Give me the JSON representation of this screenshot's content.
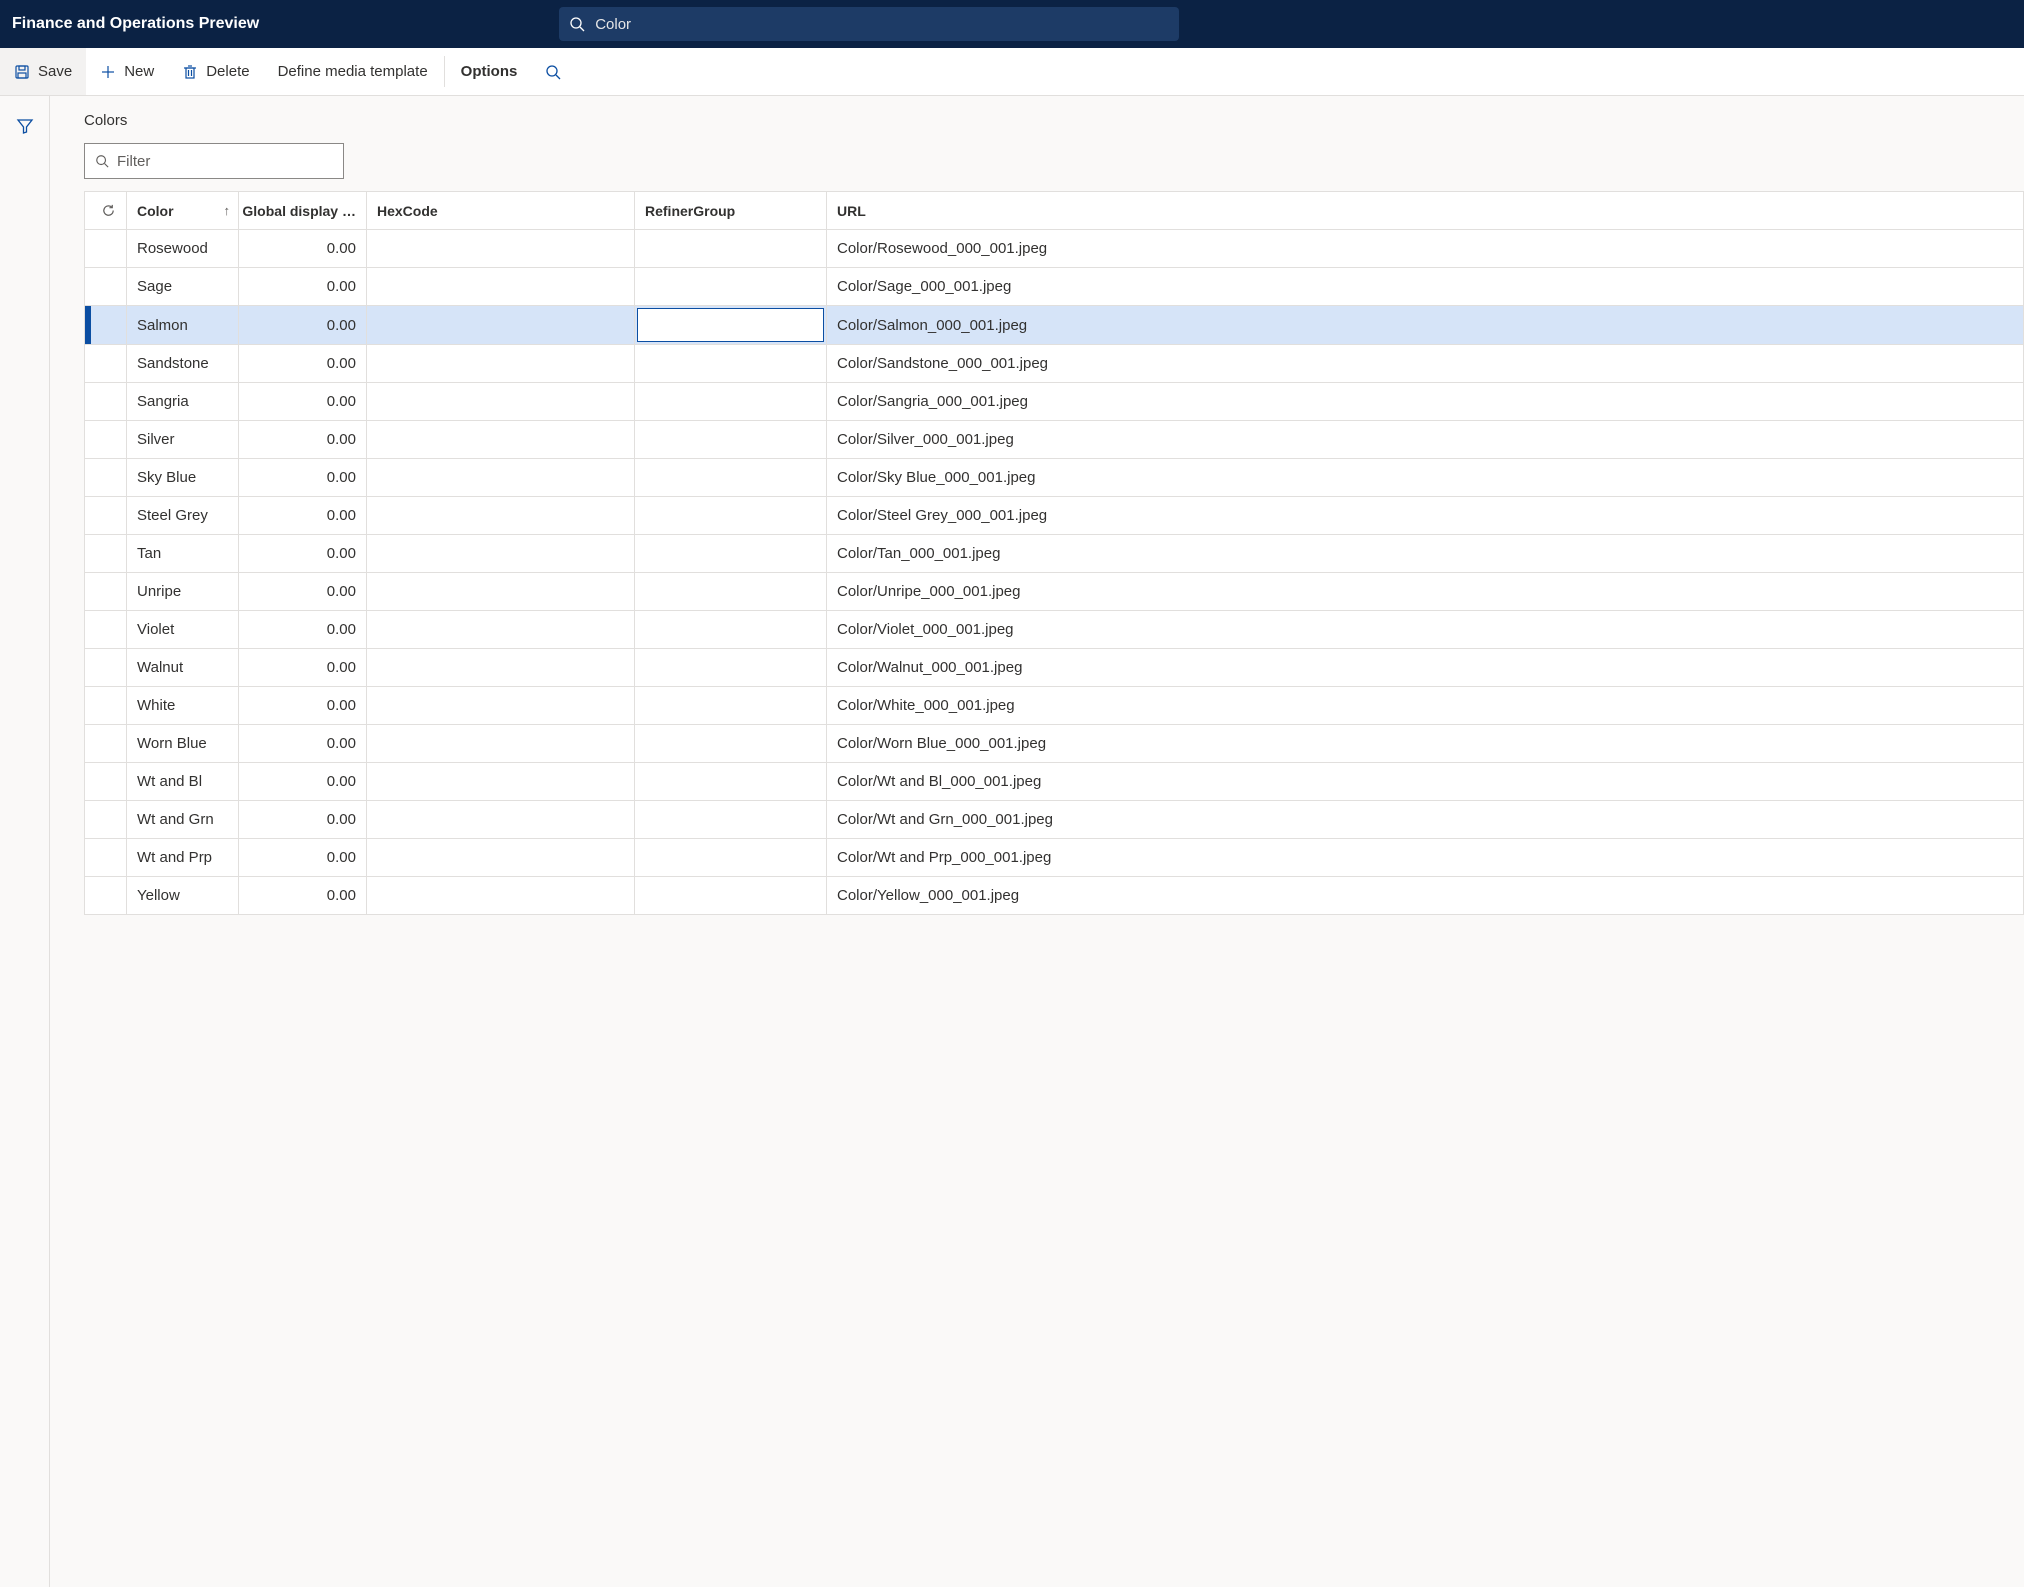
{
  "app_title": "Finance and Operations Preview",
  "search_value": "Color",
  "cmdbar": {
    "save": "Save",
    "new": "New",
    "delete": "Delete",
    "define": "Define media template",
    "options": "Options"
  },
  "page_heading": "Colors",
  "filter_placeholder": "Filter",
  "columns": {
    "color": "Color",
    "global": "Global display …",
    "hex": "HexCode",
    "refiner": "RefinerGroup",
    "url": "URL"
  },
  "selected_index": 2,
  "active_cell_column": "refiner",
  "rows": [
    {
      "color": "Rosewood",
      "global": "0.00",
      "hex": "",
      "refiner": "",
      "url": "Color/Rosewood_000_001.jpeg"
    },
    {
      "color": "Sage",
      "global": "0.00",
      "hex": "",
      "refiner": "",
      "url": "Color/Sage_000_001.jpeg"
    },
    {
      "color": "Salmon",
      "global": "0.00",
      "hex": "",
      "refiner": "",
      "url": "Color/Salmon_000_001.jpeg"
    },
    {
      "color": "Sandstone",
      "global": "0.00",
      "hex": "",
      "refiner": "",
      "url": "Color/Sandstone_000_001.jpeg"
    },
    {
      "color": "Sangria",
      "global": "0.00",
      "hex": "",
      "refiner": "",
      "url": "Color/Sangria_000_001.jpeg"
    },
    {
      "color": "Silver",
      "global": "0.00",
      "hex": "",
      "refiner": "",
      "url": "Color/Silver_000_001.jpeg"
    },
    {
      "color": "Sky Blue",
      "global": "0.00",
      "hex": "",
      "refiner": "",
      "url": "Color/Sky Blue_000_001.jpeg"
    },
    {
      "color": "Steel Grey",
      "global": "0.00",
      "hex": "",
      "refiner": "",
      "url": "Color/Steel Grey_000_001.jpeg"
    },
    {
      "color": "Tan",
      "global": "0.00",
      "hex": "",
      "refiner": "",
      "url": "Color/Tan_000_001.jpeg"
    },
    {
      "color": "Unripe",
      "global": "0.00",
      "hex": "",
      "refiner": "",
      "url": "Color/Unripe_000_001.jpeg"
    },
    {
      "color": "Violet",
      "global": "0.00",
      "hex": "",
      "refiner": "",
      "url": "Color/Violet_000_001.jpeg"
    },
    {
      "color": "Walnut",
      "global": "0.00",
      "hex": "",
      "refiner": "",
      "url": "Color/Walnut_000_001.jpeg"
    },
    {
      "color": "White",
      "global": "0.00",
      "hex": "",
      "refiner": "",
      "url": "Color/White_000_001.jpeg"
    },
    {
      "color": "Worn Blue",
      "global": "0.00",
      "hex": "",
      "refiner": "",
      "url": "Color/Worn Blue_000_001.jpeg"
    },
    {
      "color": "Wt and Bl",
      "global": "0.00",
      "hex": "",
      "refiner": "",
      "url": "Color/Wt and Bl_000_001.jpeg"
    },
    {
      "color": "Wt and Grn",
      "global": "0.00",
      "hex": "",
      "refiner": "",
      "url": "Color/Wt and Grn_000_001.jpeg"
    },
    {
      "color": "Wt and Prp",
      "global": "0.00",
      "hex": "",
      "refiner": "",
      "url": "Color/Wt and Prp_000_001.jpeg"
    },
    {
      "color": "Yellow",
      "global": "0.00",
      "hex": "",
      "refiner": "",
      "url": "Color/Yellow_000_001.jpeg"
    }
  ]
}
